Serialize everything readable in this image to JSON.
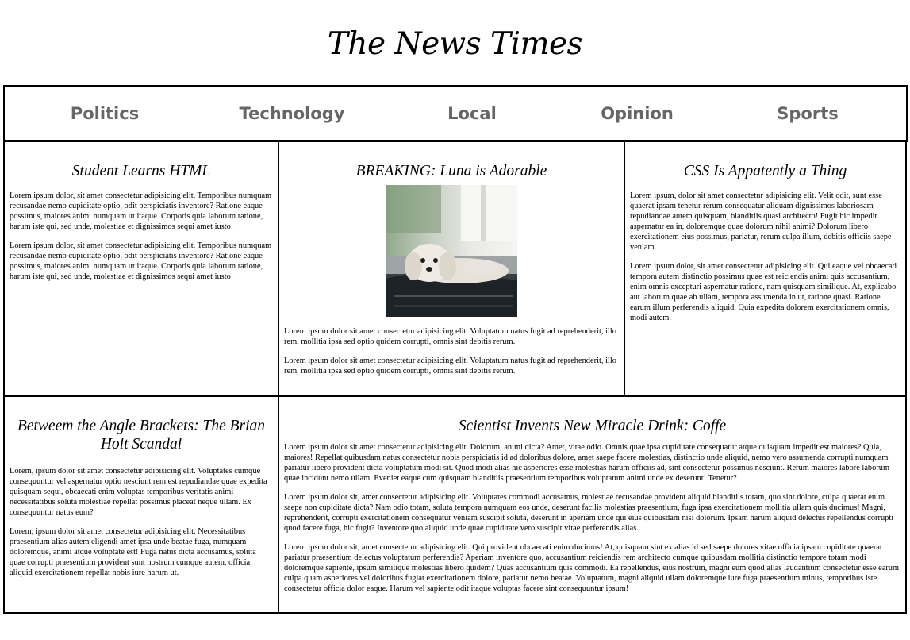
{
  "site": {
    "title": "The News Times"
  },
  "nav": {
    "items": [
      "Politics",
      "Technology",
      "Local",
      "Opinion",
      "Sports"
    ]
  },
  "articles": {
    "a1": {
      "title": "Student Learns HTML",
      "paragraphs": [
        "Lorem ipsum dolor, sit amet consectetur adipisicing elit. Temporibus numquam recusandae nemo cupiditate optio, odit perspiciatis inventore? Ratione eaque possimus, maiores animi numquam ut itaque. Corporis quia laborum ratione, harum iste qui, sed unde, molestiae et dignissimos sequi amet iusto!",
        "Lorem ipsum dolor, sit amet consectetur adipisicing elit. Temporibus numquam recusandae nemo cupiditate optio, odit perspiciatis inventore? Ratione eaque possimus, maiores animi numquam ut itaque. Corporis quia laborum ratione, harum iste qui, sed unde, molestiae et dignissimos sequi amet iusto!"
      ]
    },
    "a2": {
      "title": "BREAKING: Luna is Adorable",
      "image": "photo of a small white dog resting on a black suitcase",
      "paragraphs": [
        "Lorem ipsum dolor sit amet consectetur adipisicing elit. Voluptatum natus fugit ad reprehenderit, illo rem, mollitia ipsa sed optio quidem corrupti, omnis sint debitis rerum.",
        "Lorem ipsum dolor sit amet consectetur adipisicing elit. Voluptatum natus fugit ad reprehenderit, illo rem, mollitia ipsa sed optio quidem corrupti, omnis sint debitis rerum."
      ]
    },
    "a3": {
      "title": "CSS Is Appatently a Thing",
      "paragraphs": [
        "Lorem ipsum, dolor sit amet consectetur adipisicing elit. Velit odit, sunt esse quaerat ipsam tenetur rerum consequatur aliquam dignissimos laboriosam repudiandae autem quisquam, blanditiis quasi architecto! Fugit hic impedit aspernatur ea in, doloremque quae dolorum nihil animi? Dolorum libero exercitationem eius possimus, pariatur, rerum culpa illum, debitis officiis saepe veniam.",
        "Lorem ipsum dolor, sit amet consectetur adipisicing elit. Qui eaque vel obcaecati tempora autem distinctio possimus quae est reiciendis animi quis accusantium, enim omnis excepturi aspernatur ratione, nam quisquam similique. At, explicabo aut laborum quae ab ullam, tempora assumenda in ut, ratione quasi. Ratione earum illum perferendis aliquid. Quia expedita dolorem exercitationem omnis, modi autem."
      ]
    },
    "a4": {
      "title": "Betweem the Angle Brackets: The Brian Holt Scandal",
      "paragraphs": [
        "Lorem, ipsum dolor sit amet consectetur adipisicing elit. Voluptates cumque consequuntur vel aspernatur optio nesciunt rem est repudiandae quae expedita quisquam sequi, obcaecati enim voluptas temporibus veritatis animi necessitatibus soluta molestiae repellat possimus placeat neque ullam. Ex consequuntur natus eum?",
        "Lorem, ipsum dolor sit amet consectetur adipisicing elit. Necessitatibus praesentium alias autem eligendi amet ipsa unde beatae fuga, numquam doloremque, animi atque voluptate est! Fuga natus dicta accusamus, soluta quae corrupti praesentium provident sunt nostrum cumque autem, officia aliquid exercitationem repellat nobis iure harum ut."
      ]
    },
    "a5": {
      "title": "Scientist Invents New Miracle Drink: Coffe",
      "paragraphs": [
        "Lorem ipsum dolor sit amet consectetur adipisicing elit. Dolorum, animi dicta? Amet, vitae odio. Omnis quae ipsa cupiditate consequatur atque quisquam impedit est maiores? Quia, maiores! Repellat quibusdam natus consectetur nobis perspiciatis id ad doloribus dolore, amet saepe facere molestias, distinctio unde aliquid, nemo vero assumenda corrupti numquam pariatur libero provident dicta voluptatum modi sit. Quod modi alias hic asperiores esse molestias harum officiis ad, sint consectetur possimus nesciunt. Rerum maiores labore laborum quae incidunt nemo ullam. Eveniet eaque cum quisquam blanditiis praesentium temporibus voluptatum animi unde ex deserunt! Tenetur?",
        "Lorem ipsum dolor sit, amet consectetur adipisicing elit. Voluptates commodi accusamus, molestiae recusandae provident aliquid blanditiis totam, quo sint dolore, culpa quaerat enim saepe non cupiditate dicta? Nam odio totam, soluta tempora numquam eos unde, deserunt facilis molestias praesentium, fuga ipsa exercitationem mollitia ullam quis ducimus! Magni, reprehenderit, corrupti exercitationem consequatur veniam suscipit soluta, deserunt in aperiam unde qui eius quibusdam nisi dolorum. Ipsam harum aliquid delectus repellendus corrupti quod facere fuga, hic fugit? Inventore quo aliquid unde quae cupiditate vero suscipit vitae perferendis alias.",
        "Lorem ipsum dolor sit, amet consectetur adipisicing elit. Qui provident obcaecati enim ducimus! At, quisquam sint ex alias id sed saepe dolores vitae officia ipsam cupiditate quaerat pariatur praesentium delectus voluptatum perferendis? Aperiam inventore quo, accusantium reiciendis rem architecto cumque quibusdam mollitia distinctio tempore totam modi doloremque sapiente, ipsum similique molestias libero quidem? Quas accusantium quis commodi. Ea repellendus, eius nostrum, magni eum quod alias laudantium consectetur esse earum culpa quam asperiores vel doloribus fugiat exercitationem dolore, pariatur nemo beatae. Voluptatum, magni aliquid ullam doloremque iure fuga praesentium minus, temporibus iste consectetur officia dolor eaque. Harum vel sapiente odit itaque voluptas facere sint consequuntur ipsum!"
      ]
    }
  }
}
